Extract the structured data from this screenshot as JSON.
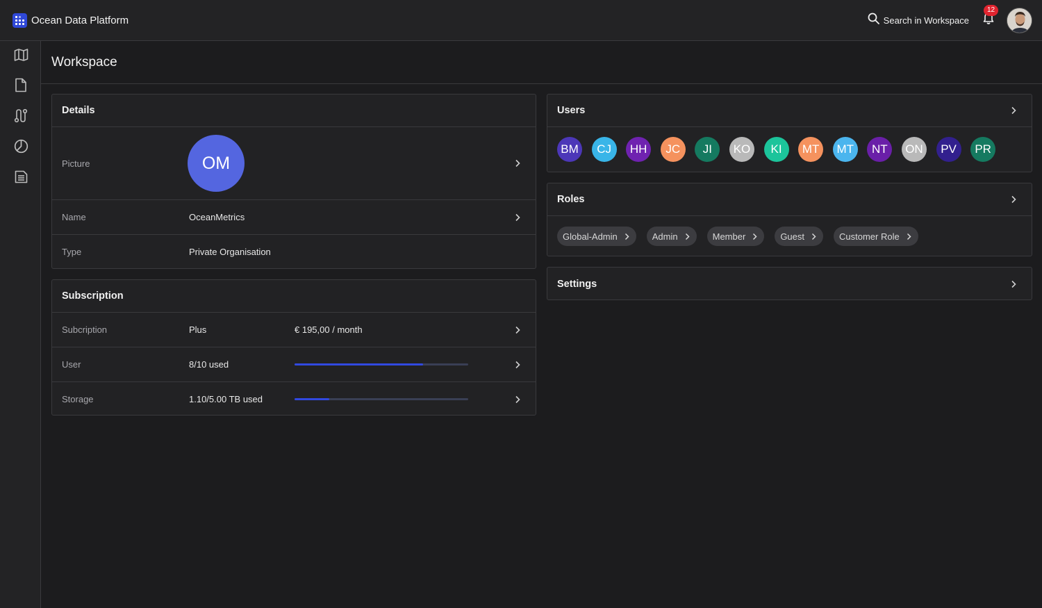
{
  "app": {
    "title": "Ocean Data Platform"
  },
  "search": {
    "label": "Search in Workspace"
  },
  "notifications": {
    "count": "12"
  },
  "sidebar": {
    "items": [
      {
        "name": "map-icon"
      },
      {
        "name": "file-icon"
      },
      {
        "name": "route-icon"
      },
      {
        "name": "chart-pie-icon"
      },
      {
        "name": "document-list-icon"
      }
    ]
  },
  "page": {
    "title": "Workspace"
  },
  "details": {
    "title": "Details",
    "picture_label": "Picture",
    "picture_initials": "OM",
    "name_label": "Name",
    "name_value": "OceanMetrics",
    "type_label": "Type",
    "type_value": "Private Organisation"
  },
  "subscription": {
    "title": "Subscription",
    "rows": [
      {
        "label": "Subcription",
        "value": "Plus",
        "extra": "€ 195,00 / month"
      },
      {
        "label": "User",
        "value": "8/10 used",
        "progress": 0.74
      },
      {
        "label": "Storage",
        "value": "1.10/5.00 TB used",
        "progress": 0.2
      }
    ]
  },
  "users": {
    "title": "Users",
    "list": [
      {
        "initials": "BM",
        "color": "#4c37b8"
      },
      {
        "initials": "CJ",
        "color": "#39b5e8"
      },
      {
        "initials": "HH",
        "color": "#6f22b0"
      },
      {
        "initials": "JC",
        "color": "#f5925e"
      },
      {
        "initials": "JI",
        "color": "#157a60"
      },
      {
        "initials": "KO",
        "color": "#b9b9b9"
      },
      {
        "initials": "KI",
        "color": "#1cc49b"
      },
      {
        "initials": "MT",
        "color": "#f5925e"
      },
      {
        "initials": "MT",
        "color": "#4bb5ee"
      },
      {
        "initials": "NT",
        "color": "#6a1fa8"
      },
      {
        "initials": "ON",
        "color": "#b9b9b9"
      },
      {
        "initials": "PV",
        "color": "#32208e"
      },
      {
        "initials": "PR",
        "color": "#157a60"
      }
    ]
  },
  "roles": {
    "title": "Roles",
    "list": [
      "Global-Admin",
      "Admin",
      "Member",
      "Guest",
      "Customer Role"
    ]
  },
  "settings": {
    "title": "Settings"
  },
  "colors": {
    "accent": "#3149e0",
    "background": "#1c1c1e",
    "panel": "#222224"
  }
}
